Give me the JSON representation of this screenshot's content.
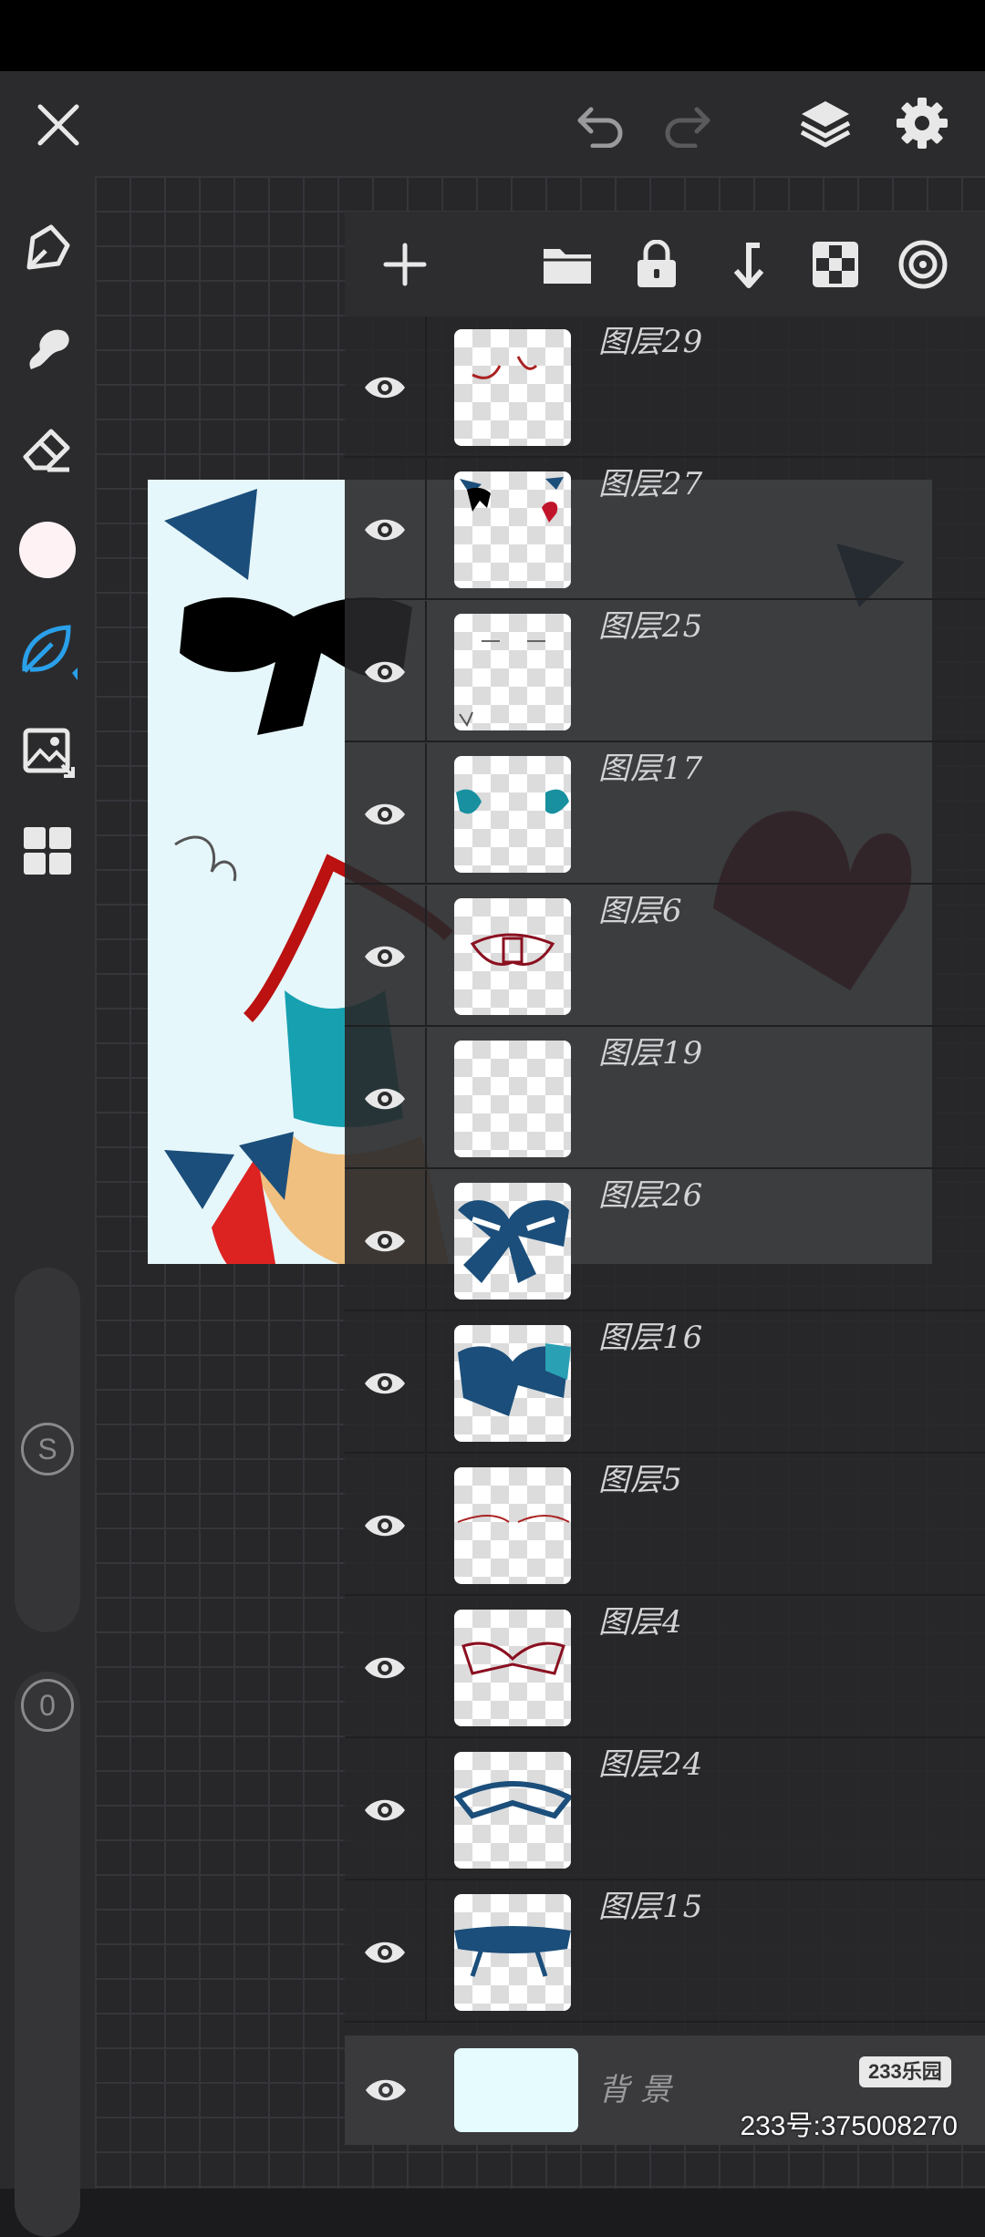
{
  "layers": [
    {
      "name": "图层29"
    },
    {
      "name": "图层27"
    },
    {
      "name": "图层25"
    },
    {
      "name": "图层17"
    },
    {
      "name": "图层6"
    },
    {
      "name": "图层19"
    },
    {
      "name": "图层26"
    },
    {
      "name": "图层16"
    },
    {
      "name": "图层5"
    },
    {
      "name": "图层4"
    },
    {
      "name": "图层24"
    },
    {
      "name": "图层15"
    }
  ],
  "background_layer": {
    "name": "背景"
  },
  "sliders": {
    "size_label": "S",
    "opacity_label": "0"
  },
  "watermark": {
    "logo": "233乐园",
    "id_text": "233号:375008270"
  },
  "colors": {
    "accent": "#2aa0ea",
    "current_color": "#fff2f4",
    "toolbar": "#2b2b2d"
  },
  "icons": [
    "close-icon",
    "undo-icon",
    "redo-icon",
    "layers-icon",
    "settings-icon",
    "pen-icon",
    "smudge-icon",
    "eraser-icon",
    "color-swatch",
    "leaf-brush-icon",
    "image-import-icon",
    "grid-icon",
    "add-layer-icon",
    "folder-icon",
    "lock-icon",
    "merge-down-icon",
    "transparency-icon",
    "target-icon",
    "eye-icon"
  ]
}
